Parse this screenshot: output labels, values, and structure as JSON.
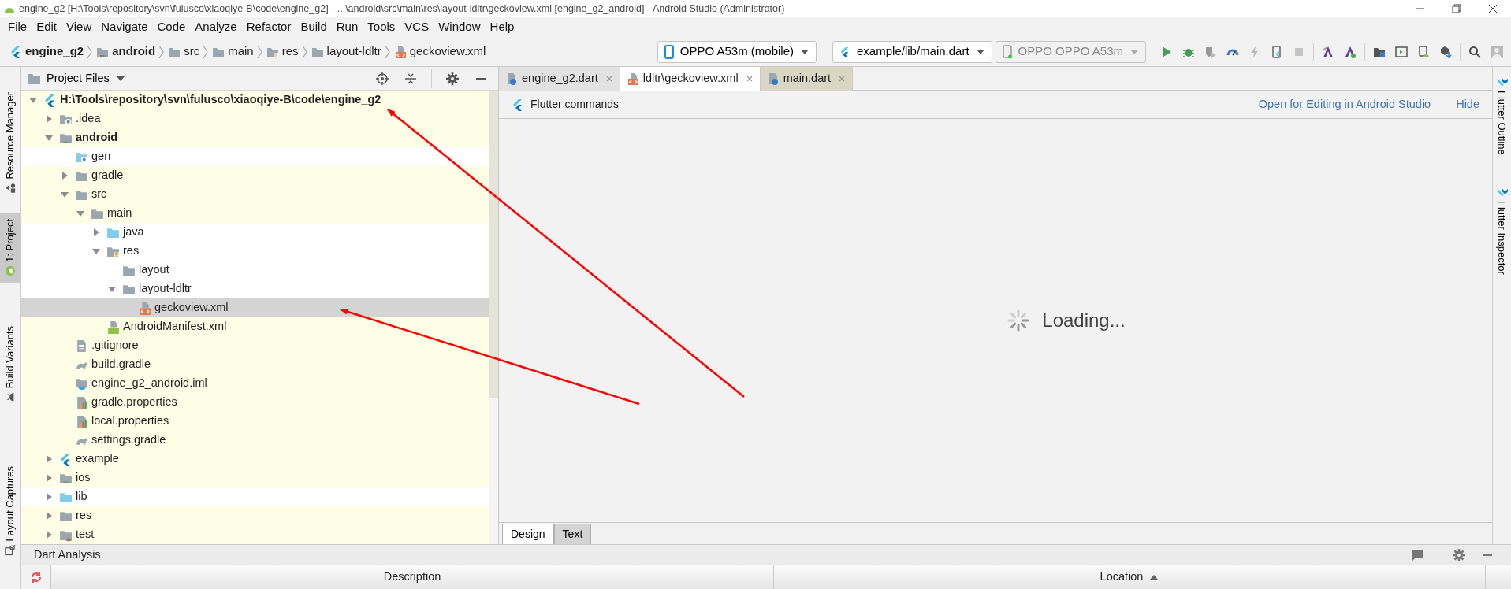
{
  "window": {
    "title": "engine_g2 [H:\\Tools\\repository\\svn\\fulusco\\xiaoqiye-B\\code\\engine_g2] - ...\\android\\src\\main\\res\\layout-ldltr\\geckoview.xml [engine_g2_android] - Android Studio (Administrator)"
  },
  "menu": [
    "File",
    "Edit",
    "View",
    "Navigate",
    "Code",
    "Analyze",
    "Refactor",
    "Build",
    "Run",
    "Tools",
    "VCS",
    "Window",
    "Help"
  ],
  "breadcrumbs": [
    {
      "label": "engine_g2",
      "kind": "flutter",
      "bold": true
    },
    {
      "label": "android",
      "kind": "module",
      "bold": true
    },
    {
      "label": "src",
      "kind": "folder",
      "bold": false
    },
    {
      "label": "main",
      "kind": "folder",
      "bold": false
    },
    {
      "label": "res",
      "kind": "res",
      "bold": false
    },
    {
      "label": "layout-ldltr",
      "kind": "folder",
      "bold": false
    },
    {
      "label": "geckoview.xml",
      "kind": "xml",
      "bold": false
    }
  ],
  "toolbar": {
    "device": "OPPO A53m (mobile)",
    "run_config": "example/lib/main.dart",
    "target": {
      "label": "OPPO OPPO A53m",
      "disabled": true
    }
  },
  "left_stripe": [
    {
      "label": "Resource Manager",
      "selected": false
    },
    {
      "label": "1: Project",
      "selected": true
    },
    {
      "label": "Build Variants",
      "selected": false
    },
    {
      "label": "Layout Captures",
      "selected": false
    }
  ],
  "right_stripe": [
    {
      "label": "Flutter Outline"
    },
    {
      "label": "Flutter Inspector"
    }
  ],
  "project": {
    "view": "Project Files",
    "tree": [
      {
        "label": "H:\\Tools\\repository\\svn\\fulusco\\xiaoqiye-B\\code\\engine_g2",
        "kind": "flutter",
        "bold": true,
        "expanded": true,
        "tinted": true,
        "selected": false,
        "children": [
          {
            "label": ".idea",
            "kind": "folder-settings",
            "bold": false,
            "expanded": false,
            "tinted": true,
            "selected": false
          },
          {
            "label": "android",
            "kind": "module",
            "bold": true,
            "expanded": true,
            "tinted": true,
            "selected": false,
            "children": [
              {
                "label": "gen",
                "kind": "folder-gen",
                "bold": false,
                "tinted": false,
                "selected": false
              },
              {
                "label": "gradle",
                "kind": "folder",
                "bold": false,
                "expanded": false,
                "tinted": true,
                "selected": false
              },
              {
                "label": "src",
                "kind": "folder",
                "bold": false,
                "expanded": true,
                "tinted": true,
                "selected": false,
                "children": [
                  {
                    "label": "main",
                    "kind": "folder",
                    "bold": false,
                    "expanded": true,
                    "tinted": true,
                    "selected": false,
                    "children": [
                      {
                        "label": "java",
                        "kind": "folder-source",
                        "bold": false,
                        "expanded": false,
                        "tinted": false,
                        "selected": false
                      },
                      {
                        "label": "res",
                        "kind": "res",
                        "bold": false,
                        "expanded": true,
                        "tinted": false,
                        "selected": false,
                        "children": [
                          {
                            "label": "layout",
                            "kind": "folder",
                            "bold": false,
                            "tinted": false,
                            "selected": false
                          },
                          {
                            "label": "layout-ldltr",
                            "kind": "folder",
                            "bold": false,
                            "expanded": true,
                            "tinted": false,
                            "selected": false,
                            "children": [
                              {
                                "label": "geckoview.xml",
                                "kind": "xml",
                                "bold": false,
                                "selected": true
                              }
                            ]
                          }
                        ]
                      },
                      {
                        "label": "AndroidManifest.xml",
                        "kind": "manifest",
                        "bold": false,
                        "tinted": true,
                        "selected": false
                      }
                    ]
                  }
                ]
              },
              {
                "label": ".gitignore",
                "kind": "text",
                "bold": false,
                "tinted": true,
                "selected": false
              },
              {
                "label": "build.gradle",
                "kind": "gradle",
                "bold": false,
                "tinted": true,
                "selected": false
              },
              {
                "label": "engine_g2_android.iml",
                "kind": "iml",
                "bold": false,
                "tinted": true,
                "selected": false
              },
              {
                "label": "gradle.properties",
                "kind": "properties",
                "bold": false,
                "tinted": true,
                "selected": false
              },
              {
                "label": "local.properties",
                "kind": "properties",
                "bold": false,
                "tinted": true,
                "selected": false
              },
              {
                "label": "settings.gradle",
                "kind": "gradle",
                "bold": false,
                "tinted": true,
                "selected": false
              }
            ]
          },
          {
            "label": "example",
            "kind": "flutter",
            "bold": false,
            "expanded": false,
            "tinted": true,
            "selected": false
          },
          {
            "label": "ios",
            "kind": "module",
            "bold": false,
            "expanded": false,
            "tinted": true,
            "selected": false
          },
          {
            "label": "lib",
            "kind": "folder-source",
            "bold": false,
            "expanded": false,
            "tinted": false,
            "selected": false
          },
          {
            "label": "res",
            "kind": "folder",
            "bold": false,
            "expanded": false,
            "tinted": true,
            "selected": false
          },
          {
            "label": "test",
            "kind": "folder-test",
            "bold": false,
            "expanded": false,
            "tinted": true,
            "selected": false
          }
        ]
      }
    ]
  },
  "editor": {
    "tabs": [
      {
        "label": "engine_g2.dart",
        "kind": "dart",
        "selected": false,
        "pinned": false
      },
      {
        "label": "ldltr\\geckoview.xml",
        "kind": "xml",
        "selected": true,
        "pinned": false
      },
      {
        "label": "main.dart",
        "kind": "dart",
        "selected": false,
        "pinned": true
      }
    ],
    "banner": {
      "title": "Flutter commands",
      "links": [
        "Open for Editing in Android Studio",
        "Hide"
      ]
    },
    "loading": "Loading...",
    "bottom_tabs": [
      {
        "label": "Design",
        "selected": true
      },
      {
        "label": "Text",
        "selected": false
      }
    ]
  },
  "dart_analysis": {
    "title": "Dart Analysis",
    "columns": [
      {
        "label": "Description",
        "sorted": false
      },
      {
        "label": "Location",
        "sorted": true
      }
    ]
  }
}
